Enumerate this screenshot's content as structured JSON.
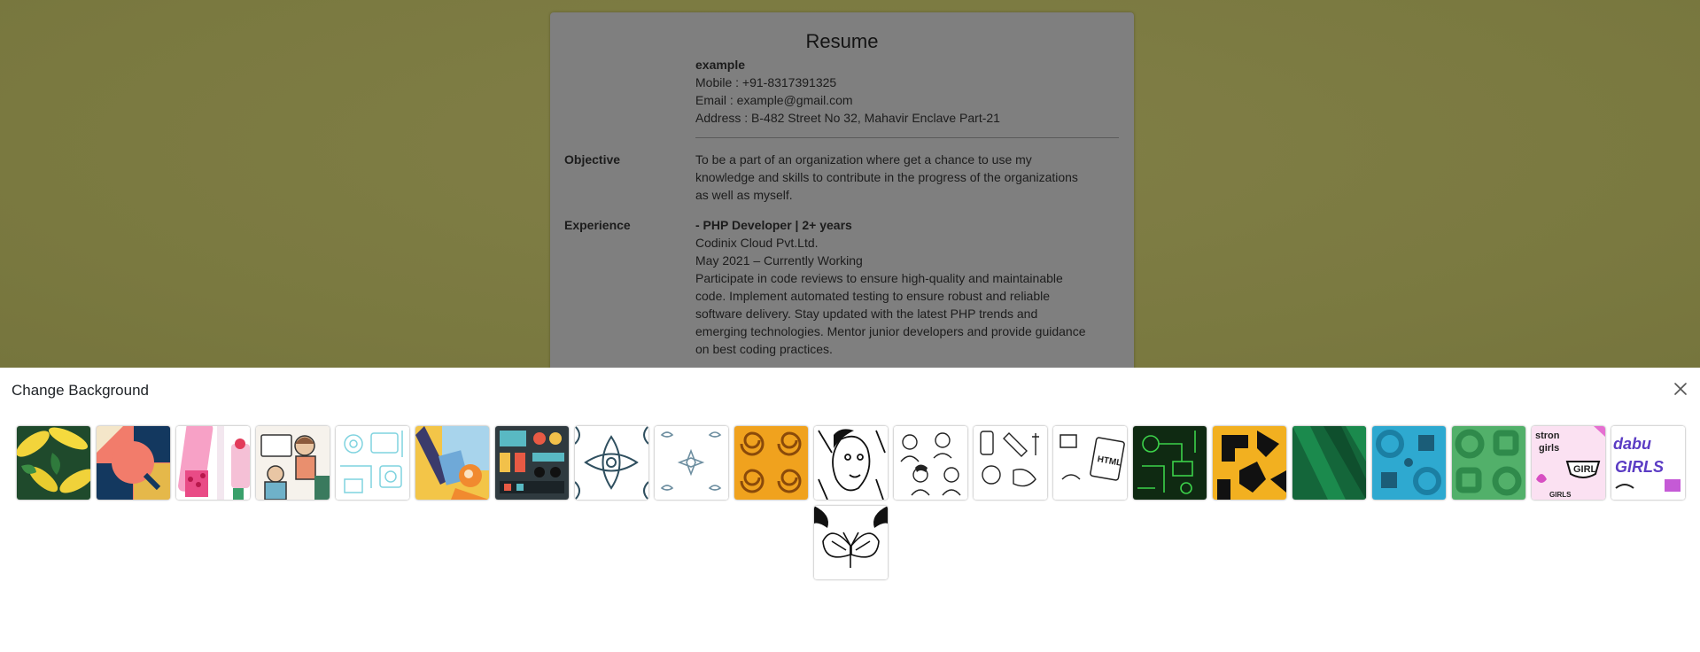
{
  "resume": {
    "title": "Resume",
    "name": "example",
    "mobile": "Mobile : +91-8317391325",
    "email": "Email : example@gmail.com",
    "address": "Address : B-482 Street No 32, Mahavir Enclave Part-21",
    "objective_heading": "Objective",
    "objective_lines": [
      "To be a part of an organization where get a chance to use my",
      "knowledge and skills to contribute in the progress of the organizations",
      "as well as myself."
    ],
    "experience_heading": "Experience",
    "job_title": "- PHP Developer | 2+ years",
    "company": "Codinix Cloud Pvt.Ltd.",
    "period": "May 2021 – Currently Working",
    "description_lines": [
      "Participate in code reviews to ensure high-quality and maintainable",
      "code. Implement automated testing to ensure robust and reliable",
      "software delivery. Stay updated with the latest PHP trends and",
      "emerging technologies. Mentor junior developers and provide guidance",
      "on best coding practices."
    ]
  },
  "panel": {
    "title": "Change Background",
    "close_icon": "close-icon",
    "backgrounds": [
      "banana-leaf-pattern",
      "geometric-coral-navy-pattern",
      "pink-drinks-pattern",
      "doodle-people-pattern",
      "cyan-line-icons-pattern",
      "orange-yellow-illustration-pattern",
      "synth-machine-pattern",
      "white-ornament-pattern",
      "white-birds-ornament-pattern",
      "orange-swirl-pattern",
      "sketch-face-pattern",
      "sketch-people-pattern",
      "sketch-objects-pattern",
      "html-doodle-pattern",
      "green-circuit-pattern",
      "black-yellow-tribal-pattern",
      "green-stripes-pattern",
      "blue-circles-pattern",
      "green-circles-pattern",
      "strong-girls-pattern",
      "purple-girls-lettering-pattern",
      "butterfly-sketch-pattern"
    ]
  },
  "colors": {
    "page_background": "#7d7c42",
    "card_background": "#7f7f7f",
    "panel_background": "#ffffff"
  }
}
